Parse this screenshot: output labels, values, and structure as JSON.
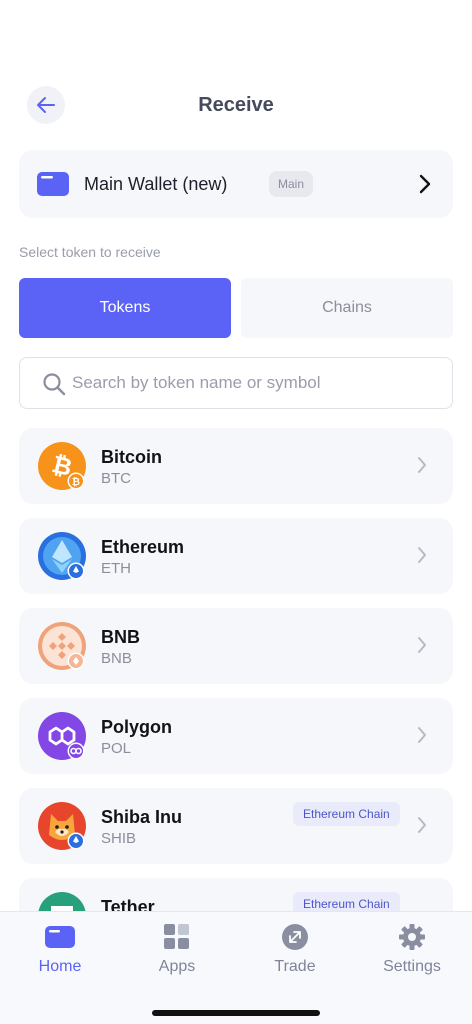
{
  "header": {
    "title": "Receive"
  },
  "wallet": {
    "name": "Main Wallet (new)",
    "badge": "Main"
  },
  "section_label": "Select token to receive",
  "tabs": [
    {
      "label": "Tokens",
      "active": true
    },
    {
      "label": "Chains",
      "active": false
    }
  ],
  "search": {
    "placeholder": "Search by token name or symbol",
    "value": ""
  },
  "tokens": [
    {
      "name": "Bitcoin",
      "symbol": "BTC",
      "chain_badge": "",
      "icon": "bitcoin-icon",
      "color": "#f7931a"
    },
    {
      "name": "Ethereum",
      "symbol": "ETH",
      "chain_badge": "",
      "icon": "ethereum-icon",
      "color": "#2a6fe0"
    },
    {
      "name": "BNB",
      "symbol": "BNB",
      "chain_badge": "",
      "icon": "bnb-icon",
      "color": "#f0a27a"
    },
    {
      "name": "Polygon",
      "symbol": "POL",
      "chain_badge": "",
      "icon": "polygon-icon",
      "color": "#8247e5"
    },
    {
      "name": "Shiba Inu",
      "symbol": "SHIB",
      "chain_badge": "Ethereum Chain",
      "icon": "shiba-inu-icon",
      "color": "#e8462c"
    },
    {
      "name": "Tether",
      "symbol": "",
      "chain_badge": "Ethereum Chain",
      "icon": "tether-icon",
      "color": "#26a17b"
    }
  ],
  "nav": [
    {
      "label": "Home",
      "icon": "wallet-icon",
      "active": true
    },
    {
      "label": "Apps",
      "icon": "apps-grid-icon",
      "active": false
    },
    {
      "label": "Trade",
      "icon": "trade-icon",
      "active": false
    },
    {
      "label": "Settings",
      "icon": "gear-icon",
      "active": false
    }
  ],
  "colors": {
    "accent": "#5b63f6",
    "card_bg": "#f6f7fb",
    "chain_badge_bg": "#e9ebfb"
  }
}
